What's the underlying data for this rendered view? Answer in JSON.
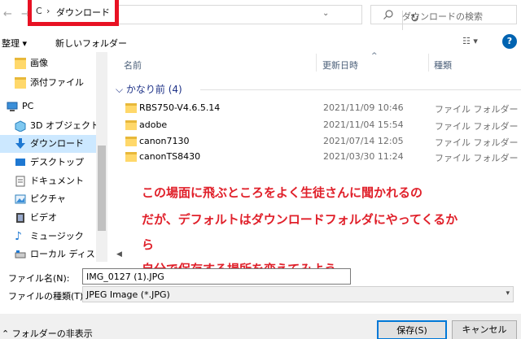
{
  "address": {
    "drive": "C",
    "crumb": "ダウンロード"
  },
  "search": {
    "placeholder": "ダウンロードの検索"
  },
  "toolbar": {
    "organize": "整理 ▾",
    "new_folder": "新しいフォルダー",
    "view": "☷ ▾",
    "help": "?"
  },
  "nav": {
    "items": [
      {
        "label": "画像"
      },
      {
        "label": "添付ファイル"
      },
      {
        "label": "PC"
      },
      {
        "label": "3D オブジェクト"
      },
      {
        "label": "ダウンロード"
      },
      {
        "label": "デスクトップ"
      },
      {
        "label": "ドキュメント"
      },
      {
        "label": "ピクチャ"
      },
      {
        "label": "ビデオ"
      },
      {
        "label": "ミュージック"
      },
      {
        "label": "ローカル ディスク (C"
      }
    ]
  },
  "columns": {
    "name": "名前",
    "modified": "更新日時",
    "type": "種類"
  },
  "group": {
    "label": "かなり前 (4)"
  },
  "files": [
    {
      "name": "RBS750-V4.6.5.14",
      "date": "2021/11/09 10:46",
      "type": "ファイル フォルダー"
    },
    {
      "name": "adobe",
      "date": "2021/11/04 15:54",
      "type": "ファイル フォルダー"
    },
    {
      "name": "canon7130",
      "date": "2021/07/14 12:05",
      "type": "ファイル フォルダー"
    },
    {
      "name": "canonTS8430",
      "date": "2021/03/30 11:24",
      "type": "ファイル フォルダー"
    }
  ],
  "annotation": {
    "line1": "この場面に飛ぶところをよく生徒さんに聞かれるの",
    "line2": "だが、デフォルトはダウンロードフォルダにやってくるか",
    "line3": "ら",
    "line4": "自分で保存する場所を変えてみよう。"
  },
  "filename": {
    "label": "ファイル名(N):",
    "value": "IMG_0127 (1).JPG"
  },
  "filetype": {
    "label": "ファイルの種類(T):",
    "value": "JPEG Image (*.JPG)"
  },
  "footer": {
    "hide_folders": "⌃ フォルダーの非表示",
    "save": "保存(S)",
    "cancel": "キャンセル"
  },
  "colors": {
    "accent": "#0078d7",
    "annotation": "#e0202a",
    "highlight_border": "#e81123"
  }
}
